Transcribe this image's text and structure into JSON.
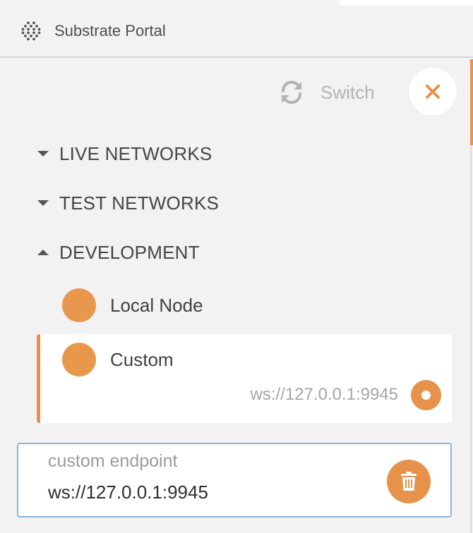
{
  "header": {
    "brand": "Substrate Portal",
    "logo_icon": "substrate-dots-logo"
  },
  "toolbar": {
    "switch_label": "Switch",
    "switch_icon": "refresh-icon",
    "close_icon": "close-icon"
  },
  "groups": [
    {
      "label": "LIVE NETWORKS",
      "expanded": false
    },
    {
      "label": "TEST NETWORKS",
      "expanded": false
    },
    {
      "label": "DEVELOPMENT",
      "expanded": true
    }
  ],
  "development": {
    "items": [
      {
        "name": "Local Node"
      },
      {
        "name": "Custom",
        "url": "ws://127.0.0.1:9945",
        "selected": true
      }
    ]
  },
  "endpoint": {
    "label": "custom endpoint",
    "value": "ws://127.0.0.1:9945",
    "delete_icon": "trash-icon"
  },
  "colors": {
    "accent": "#e7924b",
    "dot": "#e7984d",
    "focus_border": "#8fb3d6",
    "background": "#f2f2f2",
    "muted_text": "#b3b3b3"
  }
}
